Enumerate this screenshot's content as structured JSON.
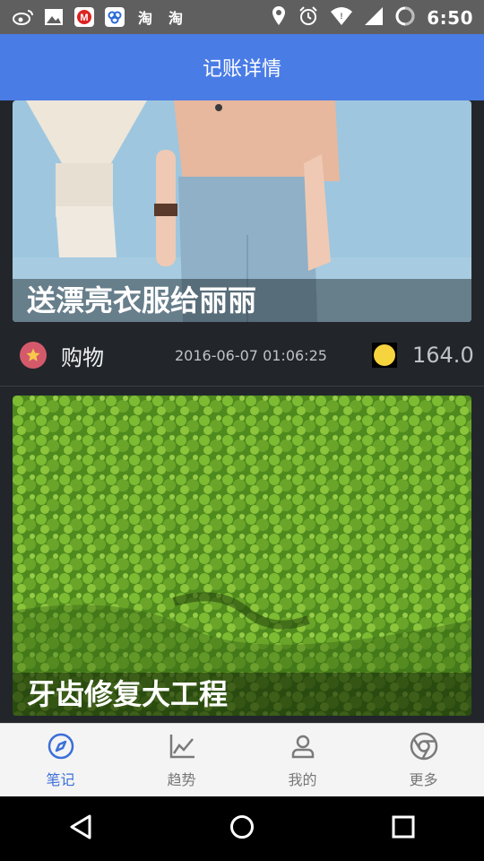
{
  "status_bar": {
    "left_icons": [
      "weibo-icon",
      "image-icon",
      "mcdonalds-icon",
      "baidu-icon",
      "taobao-icon",
      "taobao-icon"
    ],
    "taobao_text": "淘",
    "time": "6:50"
  },
  "app_bar": {
    "title": "记账详情"
  },
  "cards": [
    {
      "caption": "送漂亮衣服给丽丽",
      "category": "购物",
      "datetime": "2016-06-07 01:06:25",
      "amount": "164.0",
      "image_theme": "clothing"
    },
    {
      "caption": "牙齿修复大工程",
      "image_theme": "green-grass"
    }
  ],
  "bottom_nav": {
    "items": [
      {
        "label": "笔记",
        "icon": "compass-icon",
        "active": true
      },
      {
        "label": "趋势",
        "icon": "trend-chart-icon",
        "active": false
      },
      {
        "label": "我的",
        "icon": "user-icon",
        "active": false
      },
      {
        "label": "更多",
        "icon": "chrome-icon",
        "active": false
      }
    ]
  },
  "colors": {
    "app_bar": "#4a7ce6",
    "active_tab": "#3b6fd8",
    "background": "#22262b"
  }
}
